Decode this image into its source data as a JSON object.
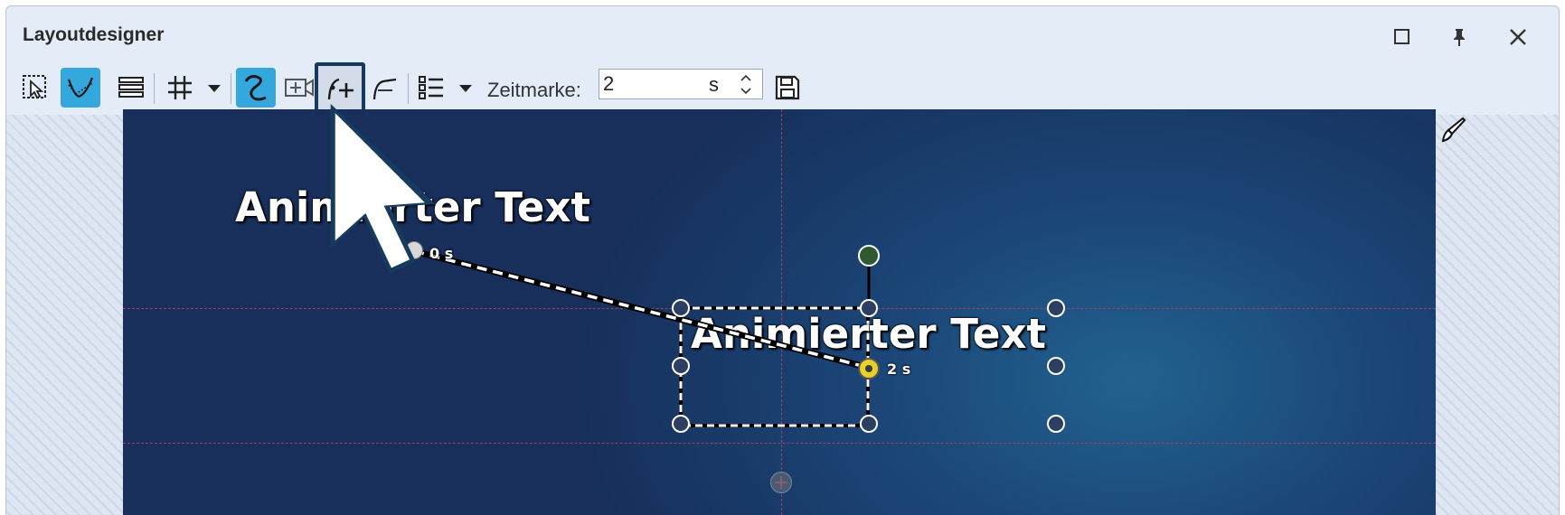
{
  "window": {
    "title": "Layoutdesigner"
  },
  "toolbar": {
    "zeitmarke_label": "Zeitmarke:",
    "zeitmarke_value": "2",
    "zeitmarke_unit": "s"
  },
  "canvas": {
    "text_start": "Animierter Text",
    "text_end": "Animierter Text",
    "time_start": "0 s",
    "time_end": "2 s"
  },
  "colors": {
    "accent": "#34a7dd",
    "pressed_border": "#173b5f",
    "stage_dark": "#172f5a",
    "stage_light": "#22628f",
    "rotation_handle": "#2f5a2f",
    "keyframe_active": "#e6d12a"
  },
  "icons": {
    "select": "select-icon",
    "path": "path-curve-icon",
    "layers": "layers-icon",
    "grid": "grid-icon",
    "motion": "motion-path-icon",
    "camera": "camera-icon",
    "add_point": "add-point-icon",
    "curve_point": "curve-point-icon",
    "list": "list-icon",
    "save": "save-icon",
    "brush": "brush-icon"
  }
}
